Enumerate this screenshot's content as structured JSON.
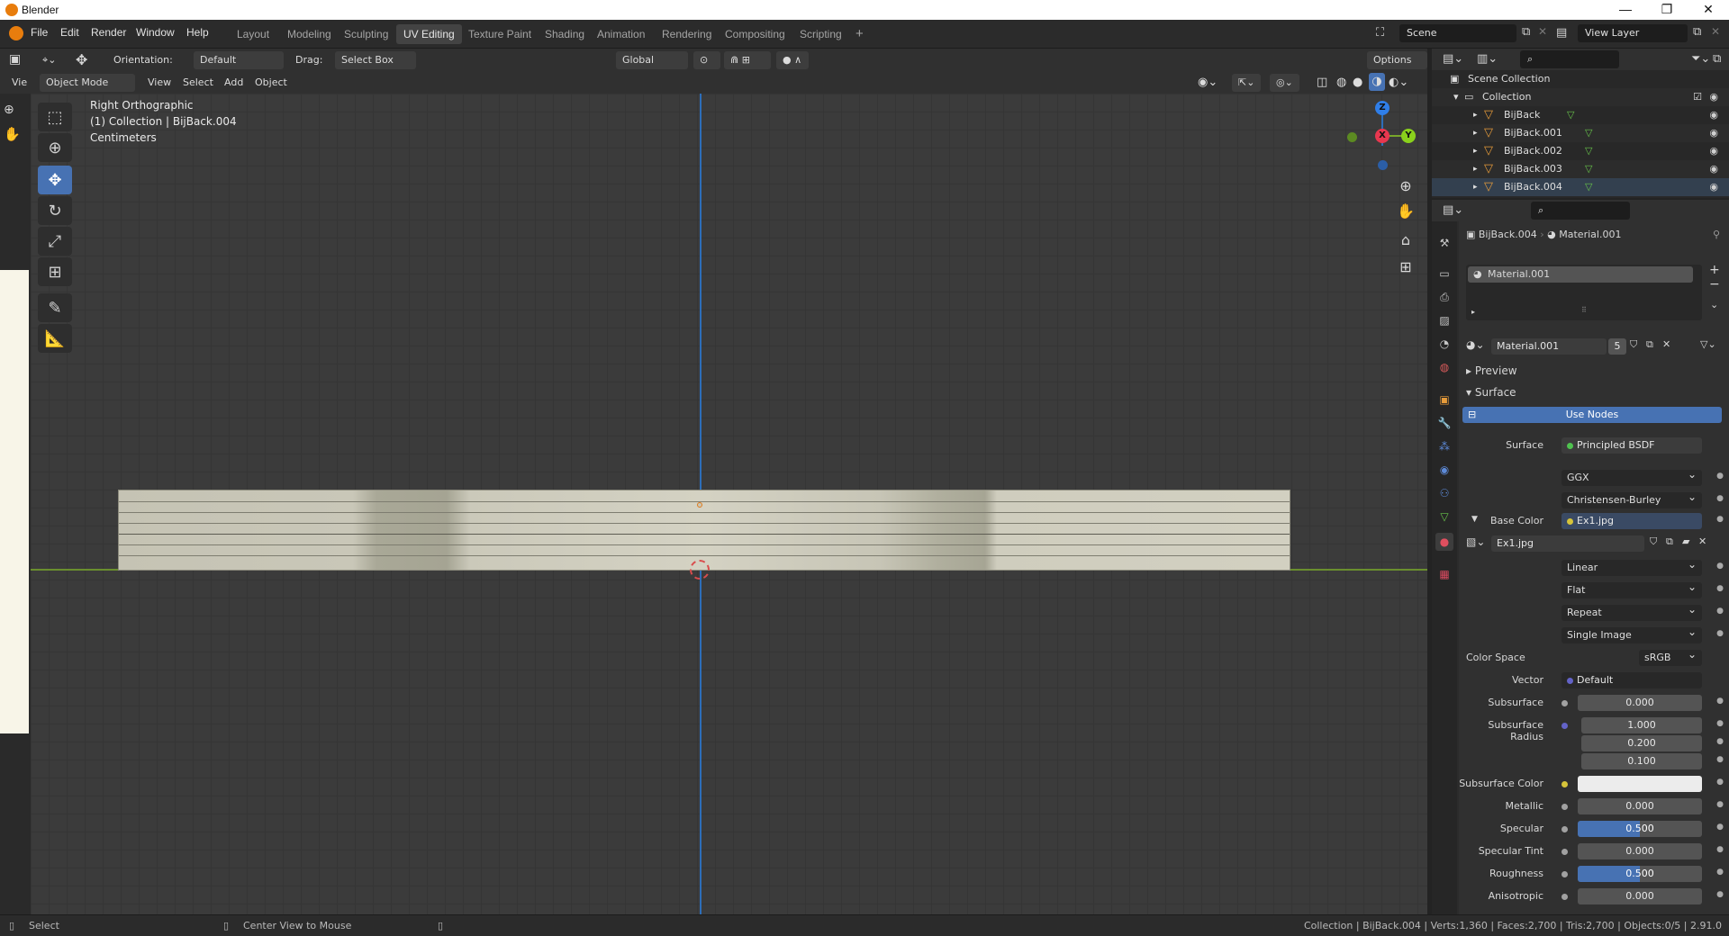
{
  "titlebar": {
    "title": "Blender",
    "min": "—",
    "max": "❐",
    "close": "✕"
  },
  "menu": [
    "File",
    "Edit",
    "Render",
    "Window",
    "Help"
  ],
  "workspaces": [
    {
      "label": "Layout",
      "active": false
    },
    {
      "label": "Modeling",
      "active": false
    },
    {
      "label": "Sculpting",
      "active": false
    },
    {
      "label": "UV Editing",
      "active": true
    },
    {
      "label": "Texture Paint",
      "active": false
    },
    {
      "label": "Shading",
      "active": false
    },
    {
      "label": "Animation",
      "active": false
    },
    {
      "label": "Rendering",
      "active": false
    },
    {
      "label": "Compositing",
      "active": false
    },
    {
      "label": "Scripting",
      "active": false
    }
  ],
  "scene": "Scene",
  "view_layer": "View Layer",
  "header": {
    "orientation_label": "Orientation:",
    "orientation_value": "Default",
    "drag_label": "Drag:",
    "drag_value": "Select Box",
    "transform": "Global",
    "options": "Options"
  },
  "header2": {
    "mode": "Object Mode",
    "menus": [
      "View",
      "Select",
      "Add",
      "Object"
    ],
    "cut_label": "Vie"
  },
  "overlay_text": {
    "view": "Right Orthographic",
    "collection": "(1) Collection | BijBack.004",
    "units": "Centimeters"
  },
  "gizmo": {
    "z": "Z",
    "x": "X",
    "y": "Y"
  },
  "outliner": {
    "root": "Scene Collection",
    "collection": "Collection",
    "objects": [
      "BijBack",
      "BijBack.001",
      "BijBack.002",
      "BijBack.003",
      "BijBack.004"
    ]
  },
  "properties": {
    "object": "BijBack.004",
    "material_breadcrumb": "Material.001",
    "slot": "Material.001",
    "material_name": "Material.001",
    "users": "5",
    "preview": "Preview",
    "surface_panel": "Surface",
    "use_nodes": "Use Nodes",
    "surface_label": "Surface",
    "surface_value": "Principled BSDF",
    "distribution": "GGX",
    "subsurface_method": "Christensen-Burley",
    "base_color_label": "Base Color",
    "base_color_value": "Ex1.jpg",
    "image_name": "Ex1.jpg",
    "interpolation": "Linear",
    "projection": "Flat",
    "extension": "Repeat",
    "source": "Single Image",
    "color_space_label": "Color Space",
    "color_space": "sRGB",
    "vector_label": "Vector",
    "vector_value": "Default",
    "rows": [
      {
        "label": "Subsurface",
        "value": "0.000",
        "dot": "#a1a1a1",
        "blue": false
      },
      {
        "label": "Subsurface Radius",
        "value": "1.000",
        "dot": "#6363c7",
        "blue": false
      },
      {
        "label": "",
        "value": "0.200",
        "dot": "",
        "blue": false
      },
      {
        "label": "",
        "value": "0.100",
        "dot": "",
        "blue": false
      }
    ],
    "subsurface_color_label": "Subsurface Color",
    "sliders": [
      {
        "label": "Metallic",
        "value": "0.000",
        "blue": false
      },
      {
        "label": "Specular",
        "value": "0.500",
        "blue": true
      },
      {
        "label": "Specular Tint",
        "value": "0.000",
        "blue": false
      },
      {
        "label": "Roughness",
        "value": "0.500",
        "blue": true
      },
      {
        "label": "Anisotropic",
        "value": "0.000",
        "blue": false
      }
    ]
  },
  "status": {
    "left": "Select",
    "middle": "Center View to Mouse",
    "right": "Collection | BijBack.004 | Verts:1,360 | Faces:2,700 | Tris:2,700 | Objects:0/5 | 2.91.0"
  },
  "colors": {
    "accent": "#4772b3",
    "axis_y": "#2d6eb9",
    "axis_x": "#6a8f2e"
  }
}
